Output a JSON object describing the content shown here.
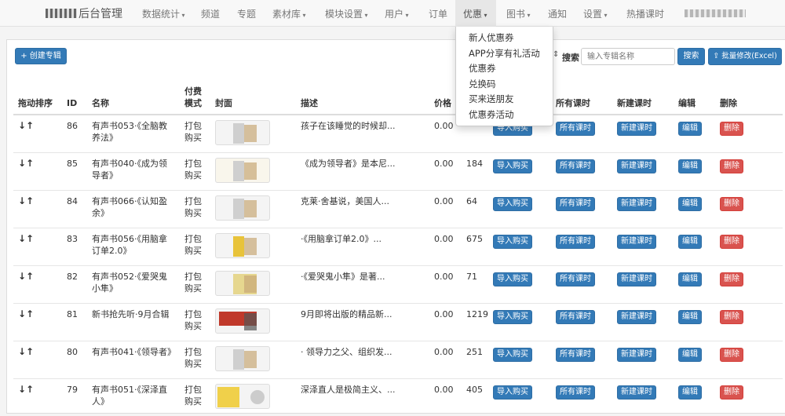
{
  "brand": {
    "title": "后台管理"
  },
  "nav": {
    "items": [
      {
        "label": "数据统计",
        "caret": true
      },
      {
        "label": "频道",
        "caret": false
      },
      {
        "label": "专题",
        "caret": false
      },
      {
        "label": "素材库",
        "caret": true
      },
      {
        "label": "模块设置",
        "caret": true
      },
      {
        "label": "用户",
        "caret": true
      },
      {
        "label": "订单",
        "caret": false
      },
      {
        "label": "优惠",
        "caret": true,
        "active": true
      },
      {
        "label": "图书",
        "caret": true
      },
      {
        "label": "通知",
        "caret": false
      },
      {
        "label": "设置",
        "caret": true
      },
      {
        "label": "热播课时",
        "caret": false
      }
    ]
  },
  "dropdown": {
    "items": [
      "新人优惠券",
      "APP分享有礼活动",
      "优惠券",
      "兑换码",
      "买来送朋友",
      "优惠券活动"
    ]
  },
  "toolbar": {
    "create_label": "+ 创建专辑",
    "search_label": "搜索",
    "search_placeholder": "输入专辑名称",
    "search_button": "搜索",
    "excel_button": "⇪ 批量修改(Excel)"
  },
  "table": {
    "headers": [
      "拖动排序",
      "ID",
      "名称",
      "付费模式",
      "封面",
      "描述",
      "价格",
      "",
      "",
      "所有课时",
      "新建课时",
      "编辑",
      "删除"
    ],
    "rows": [
      {
        "sort": "↓↑",
        "id": "86",
        "name": "有声书053·《全脑教养法》",
        "mode": "打包购买",
        "desc": "孩子在该睡觉的时候却...",
        "price": "0.00",
        "count": "",
        "import": "导入购买",
        "all": "所有课时",
        "new": "新建课时",
        "edit": "编辑",
        "del": "删除"
      },
      {
        "sort": "↓↑",
        "id": "85",
        "name": "有声书040·《成为领导者》",
        "mode": "打包购买",
        "desc": "《成为领导者》是本尼...",
        "price": "0.00",
        "count": "184",
        "import": "导入购买",
        "all": "所有课时",
        "new": "新建课时",
        "edit": "编辑",
        "del": "删除"
      },
      {
        "sort": "↓↑",
        "id": "84",
        "name": "有声书066·《认知盈余》",
        "mode": "打包购买",
        "desc": "克莱·舍基说，美国人...",
        "price": "0.00",
        "count": "64",
        "import": "导入购买",
        "all": "所有课时",
        "new": "新建课时",
        "edit": "编辑",
        "del": "删除"
      },
      {
        "sort": "↓↑",
        "id": "83",
        "name": "有声书056·《用脑拿订单2.0》",
        "mode": "打包购买",
        "desc": "·《用脑拿订单2.0》...",
        "price": "0.00",
        "count": "675",
        "import": "导入购买",
        "all": "所有课时",
        "new": "新建课时",
        "edit": "编辑",
        "del": "删除"
      },
      {
        "sort": "↓↑",
        "id": "82",
        "name": "有声书052·《爱哭鬼小隼》",
        "mode": "打包购买",
        "desc": "·《爱哭鬼小隼》是著...",
        "price": "0.00",
        "count": "71",
        "import": "导入购买",
        "all": "所有课时",
        "new": "新建课时",
        "edit": "编辑",
        "del": "删除"
      },
      {
        "sort": "↓↑",
        "id": "81",
        "name": "新书抢先听·9月合辑",
        "mode": "打包购买",
        "desc": "9月即将出版的精品新...",
        "price": "0.00",
        "count": "1219",
        "import": "导入购买",
        "all": "所有课时",
        "new": "新建课时",
        "edit": "编辑",
        "del": "删除"
      },
      {
        "sort": "↓↑",
        "id": "80",
        "name": "有声书041·《领导者》",
        "mode": "打包购买",
        "desc": "· 领导力之父、组织发...",
        "price": "0.00",
        "count": "251",
        "import": "导入购买",
        "all": "所有课时",
        "new": "新建课时",
        "edit": "编辑",
        "del": "删除"
      },
      {
        "sort": "↓↑",
        "id": "79",
        "name": "有声书051·《深泽直人》",
        "mode": "打包购买",
        "desc": "深泽直人是极简主义、...",
        "price": "0.00",
        "count": "405",
        "import": "导入购买",
        "all": "所有课时",
        "new": "新建课时",
        "edit": "编辑",
        "del": "删除"
      }
    ]
  }
}
